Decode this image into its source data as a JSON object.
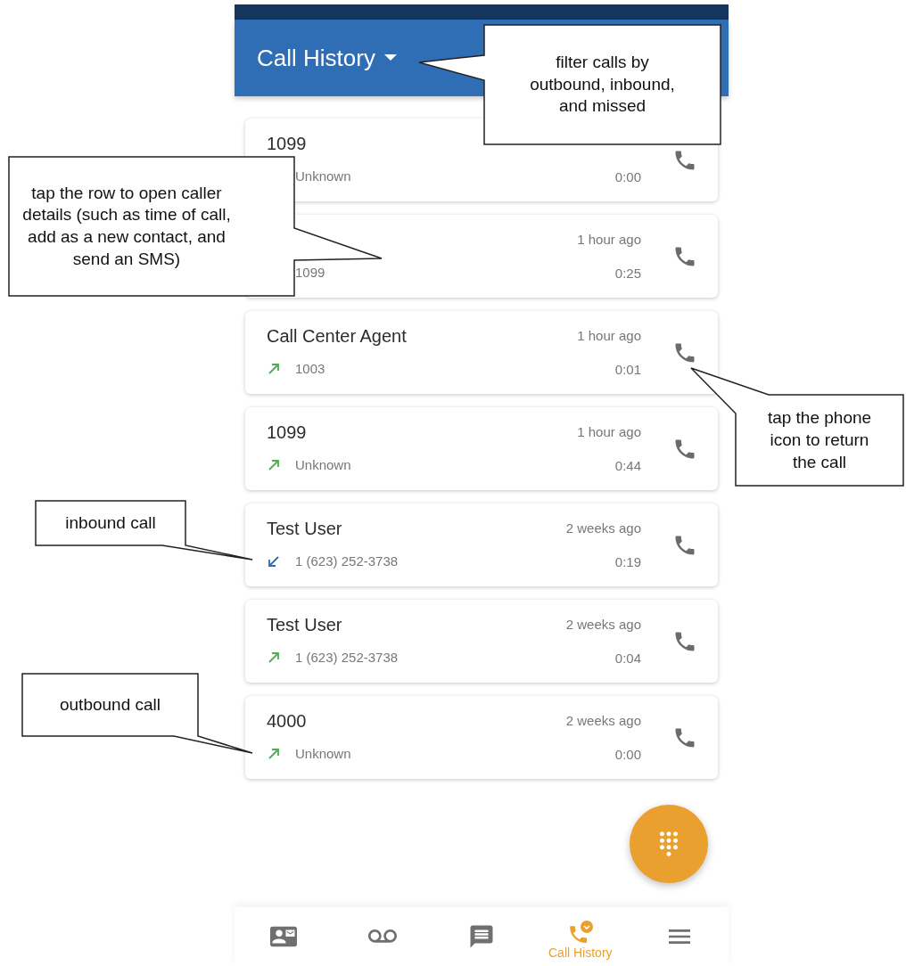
{
  "header": {
    "title": "Call History",
    "dropdown": true
  },
  "calls": [
    {
      "name": "1099",
      "number": "Unknown",
      "duration": "0:00"
    },
    {
      "time": "1 hour ago",
      "number": "1099",
      "duration": "0:25"
    },
    {
      "name": "Call Center Agent",
      "time": "1 hour ago",
      "kind": "outbound",
      "number": "1003",
      "duration": "0:01"
    },
    {
      "name": "1099",
      "time": "1 hour ago",
      "kind": "outbound",
      "number": "Unknown",
      "duration": "0:44"
    },
    {
      "name": "Test User",
      "time": "2 weeks ago",
      "kind": "inbound",
      "number": "1 (623) 252-3738",
      "duration": "0:19"
    },
    {
      "name": "Test User",
      "time": "2 weeks ago",
      "kind": "outbound",
      "number": "1 (623) 252-3738",
      "duration": "0:04"
    },
    {
      "name": "4000",
      "time": "2 weeks ago",
      "kind": "outbound",
      "number": "Unknown",
      "duration": "0:00"
    }
  ],
  "nav": [
    {
      "kind": "contacts",
      "selected": false
    },
    {
      "kind": "voicemail",
      "selected": false
    },
    {
      "kind": "messages",
      "selected": false
    },
    {
      "kind": "history",
      "selected": true,
      "label": "Call History"
    },
    {
      "kind": "menu",
      "selected": false
    }
  ],
  "callouts": [
    {
      "text": "filter calls by outbound, inbound, and missed"
    },
    {
      "text": "tap the row to open caller details (such as time of call, add as a new contact, and send an SMS)"
    },
    {
      "text": "tap the phone icon to return the call"
    },
    {
      "text": "inbound call"
    },
    {
      "text": "outbound call"
    }
  ]
}
